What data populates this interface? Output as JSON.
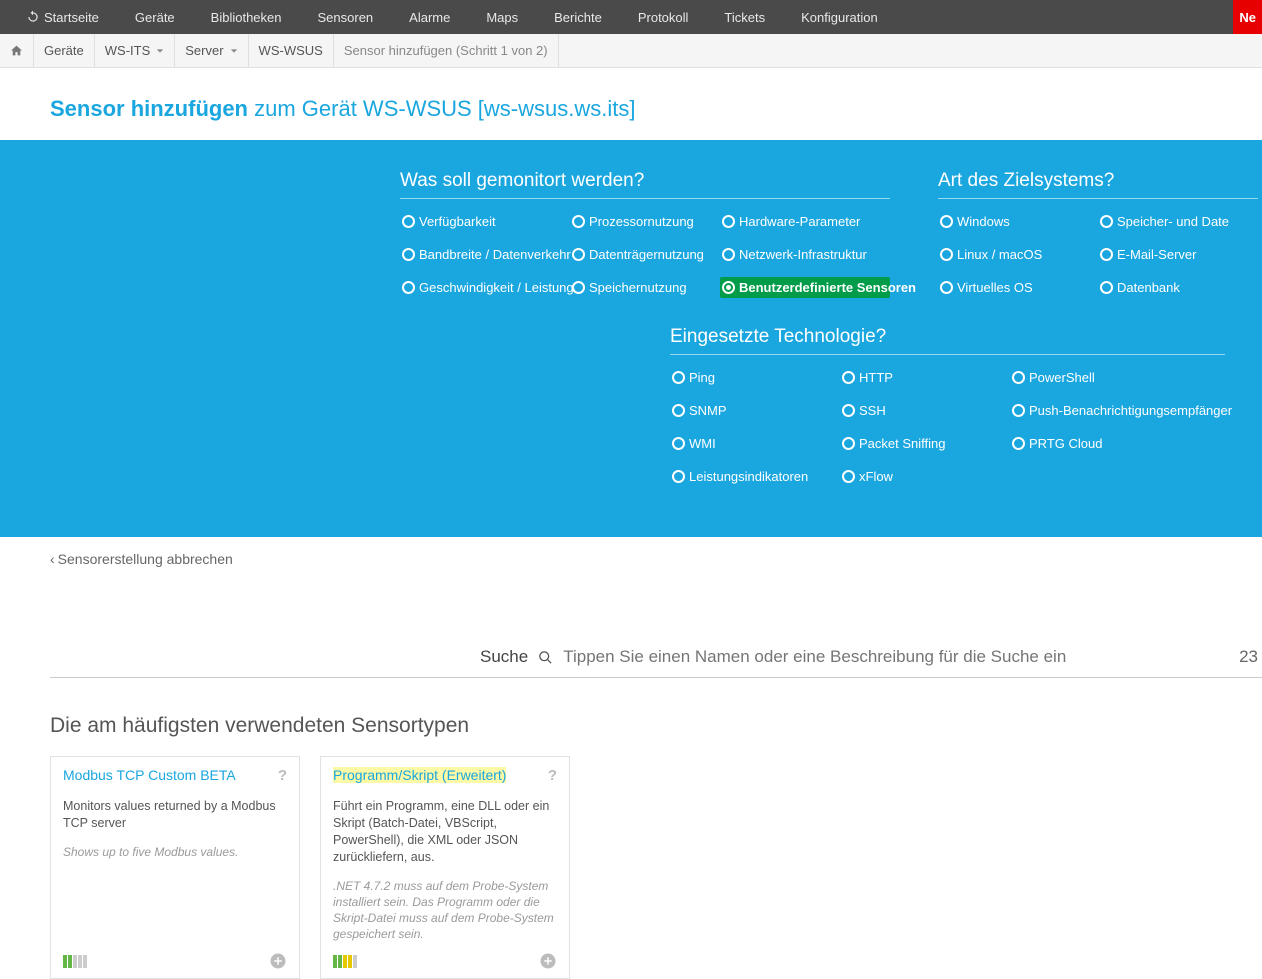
{
  "topnav": {
    "home": "Startseite",
    "items": [
      "Geräte",
      "Bibliotheken",
      "Sensoren",
      "Alarme",
      "Maps",
      "Berichte",
      "Protokoll",
      "Tickets",
      "Konfiguration"
    ],
    "new_btn": "Ne"
  },
  "breadcrumb": {
    "items": [
      "Geräte",
      "WS-ITS",
      "Server",
      "WS-WSUS"
    ],
    "last": "Sensor hinzufügen (Schritt 1 von 2)"
  },
  "title": {
    "strong": "Sensor hinzufügen",
    "rest": "zum Gerät WS-WSUS [ws-wsus.ws.its]"
  },
  "filters": {
    "monitor": {
      "title": "Was soll gemonitort werden?",
      "cols": [
        [
          "Verfügbarkeit",
          "Bandbreite / Datenverkehr",
          "Geschwindigkeit / Leistung"
        ],
        [
          "Prozessornutzung",
          "Datenträgernutzung",
          "Speichernutzung"
        ],
        [
          "Hardware-Parameter",
          "Netzwerk-Infrastruktur",
          "Benutzerdefinierte Sensoren"
        ]
      ],
      "selected": "Benutzerdefinierte Sensoren"
    },
    "target": {
      "title": "Art des Zielsystems?",
      "cols": [
        [
          "Windows",
          "Linux / macOS",
          "Virtuelles OS"
        ],
        [
          "Speicher- und Date",
          "E-Mail-Server",
          "Datenbank"
        ]
      ]
    },
    "tech": {
      "title": "Eingesetzte Technologie?",
      "cols": [
        [
          "Ping",
          "SNMP",
          "WMI",
          "Leistungsindikatoren"
        ],
        [
          "HTTP",
          "SSH",
          "Packet Sniffing",
          "xFlow"
        ],
        [
          "PowerShell",
          "Push-Benachrichtigungsempfänger",
          "PRTG Cloud"
        ]
      ]
    }
  },
  "cancel": "Sensorerstellung abbrechen",
  "search": {
    "label": "Suche",
    "placeholder": "Tippen Sie einen Namen oder eine Beschreibung für die Suche ein",
    "count": "23"
  },
  "section_title": "Die am häufigsten verwendeten Sensortypen",
  "cards": [
    {
      "title": "Modbus TCP Custom BETA",
      "desc": "Monitors values returned by a Modbus TCP server",
      "note": "Shows up to five Modbus values.",
      "bars": [
        "#64b646",
        "#64b646",
        "#ccc",
        "#ccc",
        "#ccc"
      ],
      "highlight": false
    },
    {
      "title": "Programm/Skript (Erweitert)",
      "desc": "Führt ein Programm, eine DLL oder ein Skript (Batch-Datei, VBScript, PowerShell), die XML oder JSON zurückliefern, aus.",
      "note": ".NET 4.7.2 muss auf dem Probe-System installiert sein. Das Programm oder die Skript-Datei muss auf dem Probe-System gespeichert sein.",
      "bars": [
        "#64b646",
        "#64b646",
        "#e6c800",
        "#e6c800",
        "#ccc"
      ],
      "highlight": true
    }
  ]
}
